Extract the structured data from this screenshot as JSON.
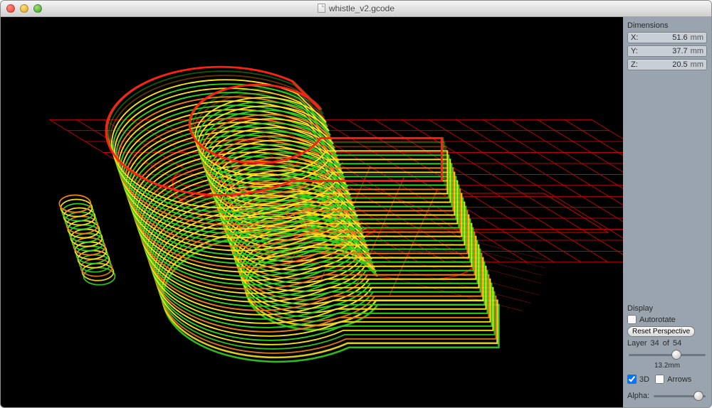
{
  "window": {
    "title": "whistle_v2.gcode"
  },
  "dimensions": {
    "heading": "Dimensions",
    "x_label": "X:",
    "x_value": "51.6",
    "x_unit": "mm",
    "y_label": "Y:",
    "y_value": "37.7",
    "y_unit": "mm",
    "z_label": "Z:",
    "z_value": "20.5",
    "z_unit": "mm"
  },
  "display": {
    "heading": "Display",
    "autorotate_label": "Autorotate",
    "autorotate_checked": false,
    "reset_btn": "Reset Perspective",
    "layer_label": "Layer",
    "layer_current": "34",
    "layer_of": "of",
    "layer_total": "54",
    "layer_slider_pct": 63,
    "layer_mm": "13.2mm",
    "view3d_label": "3D",
    "view3d_checked": true,
    "arrows_label": "Arrows",
    "arrows_checked": false,
    "alpha_label": "Alpha:",
    "alpha_slider_pct": 92
  }
}
